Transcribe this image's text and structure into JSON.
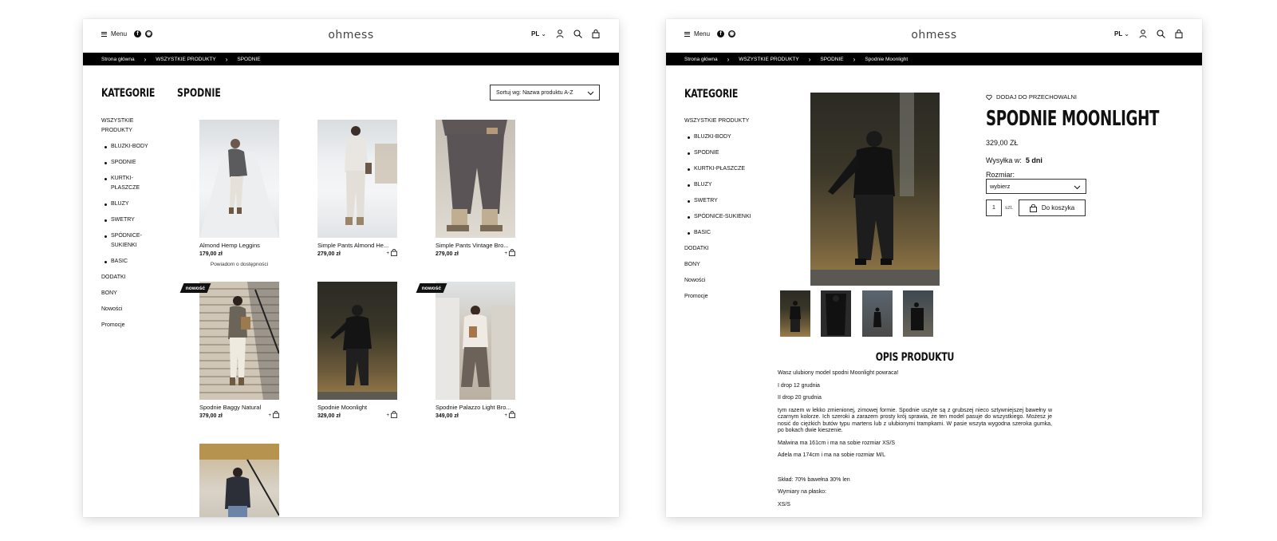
{
  "header": {
    "menu_label": "Menu",
    "logo_text": "ohmess",
    "lang": "PL",
    "facebook_icon": "f",
    "instagram_icon": "◉"
  },
  "left": {
    "breadcrumb": [
      "Strona główna",
      "›",
      "WSZYSTKIE PRODUKTY",
      "›",
      "SPODNIE"
    ],
    "sidebar_title": "KATEGORIE",
    "sidebar": {
      "all": "WSZYSTKIE PRODUKTY",
      "subs": [
        "BLUZKI-BODY",
        "SPODNIE",
        "KURTKI-PŁASZCZE",
        "BLUZY",
        "SWETRY",
        "SPÓDNICE-SUKIENKI",
        "BASIC"
      ],
      "extra": [
        "DODATKI",
        "BONY",
        "Nowości",
        "Promocje"
      ]
    },
    "page_title": "SPODNIE",
    "sort_label": "Sortuj wg: Nazwa produktu A-Z",
    "products": [
      {
        "name": "Almond Hemp Leggins",
        "price": "179,00 zł",
        "notify": "Powiadom o dostępności",
        "badge": ""
      },
      {
        "name": "Simple Pants Almond He...",
        "price": "279,00 zł",
        "plus": "+",
        "badge": ""
      },
      {
        "name": "Simple Pants Vintage Bro...",
        "price": "279,00 zł",
        "plus": "+",
        "badge": ""
      },
      {
        "name": "Spodnie Baggy Natural",
        "price": "379,00 zł",
        "plus": "+",
        "badge": "nowość"
      },
      {
        "name": "Spodnie Moonlight",
        "price": "329,00 zł",
        "plus": "+",
        "badge": ""
      },
      {
        "name": "Spodnie Palazzo Light Bro...",
        "price": "349,00 zł",
        "plus": "+",
        "badge": "nowość"
      }
    ]
  },
  "right": {
    "breadcrumb": [
      "Strona główna",
      "›",
      "WSZYSTKIE PRODUKTY",
      "›",
      "SPODNIE",
      "›",
      "Spodnie Moonlight"
    ],
    "sidebar_title": "KATEGORIE",
    "sidebar": {
      "all": "WSZYSTKIE PRODUKTY",
      "subs": [
        "BLUZKI-BODY",
        "SPODNIE",
        "KURTKI-PŁASZCZE",
        "BLUZY",
        "SWETRY",
        "SPÓDNICE-SUKIENKI",
        "BASIC"
      ],
      "extra": [
        "DODATKI",
        "BONY",
        "Nowości",
        "Promocje"
      ]
    },
    "wishlist": "DODAJ DO PRZECHOWALNI",
    "product_title": "SPODNIE MOONLIGHT",
    "price": "329,00 ZŁ",
    "shipping_label": "Wysyłka w:",
    "shipping_value": "5 dni",
    "size_label": "Rozmiar:",
    "size_placeholder": "wybierz",
    "qty": "1",
    "qty_unit": "szt.",
    "add_to_cart": "Do koszyka",
    "desc_title": "OPIS PRODUKTU",
    "desc": [
      "Wasz ulubiony model spodni Moonlight powraca!",
      "I drop 12 grudnia",
      "II drop 20 grudnia",
      "tym razem w lekko zmienionej, zimowej formie. Spodnie uszyte są z grubszej nieco sztywniejszej bawełny w czarnym kolorze. Ich szeroki a zarazem prosty krój sprawia, że ten model pasuje do wszystkiego. Możesz je nosić do ciężkich butów typu martens lub z ulubionymi trampkami. W pasie wszyta wygodna szeroka gumka, po bokach dwie kieszenie.",
      "Malwina ma 161cm i ma na sobie rozmiar XS/S",
      "Adela ma 174cm i ma na sobie rozmiar M/L",
      "",
      "Skład: 70% bawełna 30% len",
      "Wymiary na płasko:",
      "XS/S"
    ]
  }
}
